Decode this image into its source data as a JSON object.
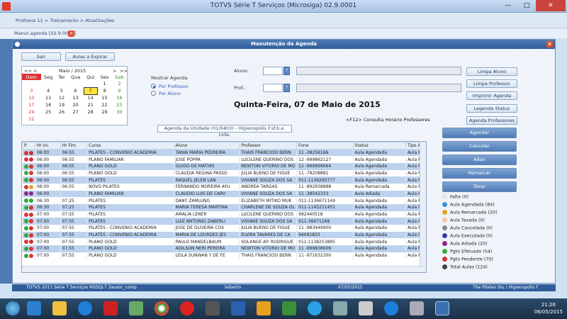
{
  "window": {
    "title": "TOTVS Série T Serviços (Microsiga) 02.9.0001"
  },
  "breadcrumb": "Protheus 11 > Treinamento > Atualizações",
  "tab": {
    "label": "Manut.agenda [02.9.0026]"
  },
  "dialog": {
    "title": "Manutenção da Agenda"
  },
  "toolbar": {
    "sair": "Sair",
    "aulas_expirar": "Aulas a Expirar"
  },
  "calendar": {
    "nav_prev_year": "<<",
    "nav_prev": "<",
    "month": "Maio / 2015",
    "nav_next": ">",
    "nav_next_year": ">>",
    "weekdays": [
      "Dom",
      "Seg",
      "Ter",
      "Qua",
      "Qui",
      "Sex",
      "Sab"
    ],
    "weeks": [
      [
        "",
        "",
        "",
        "",
        "",
        "1",
        "2"
      ],
      [
        "3",
        "4",
        "5",
        "6",
        "7",
        "8",
        "9"
      ],
      [
        "10",
        "11",
        "12",
        "13",
        "14",
        "15",
        "16"
      ],
      [
        "17",
        "18",
        "19",
        "20",
        "21",
        "22",
        "23"
      ],
      [
        "24",
        "25",
        "26",
        "27",
        "28",
        "29",
        "30"
      ],
      [
        "31",
        "",
        "",
        "",
        "",
        "",
        ""
      ]
    ],
    "selected": "7"
  },
  "mostrar": {
    "label": "Mostrar Agenda",
    "opt1": "Por Professor",
    "opt2": "Por Aluno"
  },
  "aluno_label": "Aluno:",
  "prof_label": "Prof.:",
  "date_heading": "Quinta-Feira, 07 de Maio de 2015",
  "f12_hint": "<F12> Consulta Horário Professores",
  "right_buttons": [
    "Limpa Aluno",
    "Limpa Professor",
    "Imprimir Agenda",
    "Legenda Status",
    "Agenda Professores"
  ],
  "agenda_tab": "Agenda da Unidade (01/0403) - Higienopolis F.sf.b.e. Ltda.",
  "grid": {
    "columns": [
      "P.",
      "Hr Ini",
      "Hr Fim",
      "Curso",
      "Aluno",
      "Professor",
      "Fone",
      "Status",
      "Tipo Aul"
    ],
    "rows": [
      {
        "c": [
          "#d33",
          "#c33"
        ],
        "v": [
          "06:00",
          "06:55",
          "PILATES - CONVENIO ACADEMIA",
          "TANIA MARIA PEDREIRA",
          "THAIS FRANCIOSI BERN",
          "11 -38256186",
          "Aula Agendada",
          "Aula Fix"
        ]
      },
      {
        "c": [
          "#d33",
          "#c33"
        ],
        "v": [
          "06:00",
          "06:55",
          "PLANO FAMILIAR",
          "JOSE POPPA",
          "LUCILENE QUERINO DOS",
          "12 -999862127",
          "Aula Agendada",
          "Aula Fix"
        ]
      },
      {
        "c": [
          "#3a3",
          "#d33"
        ],
        "v": [
          "06:00",
          "06:55",
          "PLANO GOLD",
          "GUIDO DE MATHIS",
          "NEWTON VITORIO DE MO",
          "11 -999999664",
          "Aula Agendada",
          "Aula Fix"
        ]
      },
      {
        "c": [
          "#3a3",
          "#d33"
        ],
        "v": [
          "06:00",
          "06:55",
          "PLANO GOLD",
          "CLAUDIA REGINA PASSO",
          "JULIA BUENO DE FIGUE",
          "11 -78208881",
          "Aula Agendada",
          "Aula Fix"
        ]
      },
      {
        "c": [
          "#3a3",
          "#d33"
        ],
        "v": [
          "06:00",
          "06:55",
          "PILATES",
          "RAQUEL JELEN LAN",
          "VIVIANE SOUZA DOS SA",
          "011-1136260777",
          "Aula Agendada",
          "Aula Fix"
        ]
      },
      {
        "c": [
          "#d33",
          "#e9a020"
        ],
        "v": [
          "06:00",
          "06:55",
          "NOVO PILATES",
          "FERNANDO MOREIRA AYU",
          "ANDREA TARGAS",
          "11 -892938888",
          "Aula Remarcada",
          "Aula Fix"
        ]
      },
      {
        "c": [
          "#8a2a8a",
          "#8a2a8a"
        ],
        "v": [
          "06:00",
          "",
          "PLANO FAMILIAR",
          "CLAUDIO LUIS DE CARV",
          "VIVIANE SOUZA DOS SA",
          "11 -38542333",
          "Aula Adiada",
          "Aula Fix"
        ]
      },
      {
        "c": [
          "#3a3",
          "#3a3"
        ],
        "v": [
          "06:30",
          "07:25",
          "PILATES",
          "DANY ZAMLUNG",
          "ELIZABETH MITIKO MUK",
          "011-1136671149",
          "Aula Agendada",
          "Aula Fix"
        ]
      },
      {
        "c": [
          "#3a3",
          "#d33"
        ],
        "v": [
          "06:30",
          "07:25",
          "PILATES",
          "MARIA TERESA MARTINA",
          "CHARLENE DE SOUZA OL",
          "011-1145251451",
          "Aula Agendada",
          "Aula Fix"
        ]
      },
      {
        "c": [
          "#d33",
          "#c33"
        ],
        "v": [
          "07:00",
          "07:55",
          "PILATES",
          "AMALIA LENER",
          "LUCILENE QUERINO DOS",
          "982440518",
          "Aula Agendada",
          "Aula Fix"
        ]
      },
      {
        "c": [
          "#3a3",
          "#d33"
        ],
        "v": [
          "07:00",
          "07:55",
          "PILATES",
          "LUIZ ANTONIO ZABERLI",
          "VIVIANE SOUZA DOS SA",
          "011-36671168",
          "Aula Agendada",
          "Aula Fix"
        ]
      },
      {
        "c": [
          "#3a3",
          "#d33"
        ],
        "v": [
          "07:00",
          "07:55",
          "PILATES - CONVENIO ACADEMIA",
          "JOSE DE OLIVEIRA COS",
          "JULIA BUENO DE FIGUE",
          "11 -983449900",
          "Aula Agendada",
          "Aula Fix"
        ]
      },
      {
        "c": [
          "#3a3",
          "#d33"
        ],
        "v": [
          "07:00",
          "07:55",
          "PILATES - CONVENIO ACADEMIA",
          "MARIA DE LOURDES JES",
          "ELVIRA TAVARES DE CA",
          "96081833",
          "Aula Agendada",
          "Aula Fix"
        ]
      },
      {
        "c": [
          "#d33",
          "#c33"
        ],
        "v": [
          "07:00",
          "07:55",
          "PLANO GOLD",
          "PAULO MANDELBAUM",
          "SOLANGE AP. RODRIGUE",
          "011-1138253895",
          "Aula Agendada",
          "Aula Fix"
        ]
      },
      {
        "c": [
          "#3a3",
          "#d33"
        ],
        "v": [
          "07:00",
          "07:55",
          "PLANO GOLD",
          "ADILSON NERI PEREIRA",
          "NEWTON VITORIO DE MO",
          "11 -999838606",
          "Aula Agendada",
          "Aula Fix"
        ]
      },
      {
        "c": [
          "#3a3",
          "#d33"
        ],
        "v": [
          "07:00",
          "07:55",
          "PLANO GOLD",
          "LEILA SUNWAN Y DE FE",
          "THAIS FRANCIOSI BERN",
          "11 -971632300",
          "Aula Agendada",
          "Aula Fix"
        ]
      }
    ]
  },
  "actions": [
    "Agendar",
    "Cancelar",
    "Adiar",
    "Remarcar",
    "Taxar"
  ],
  "legend": [
    {
      "color": "#e5e5e5",
      "label": "Falta (0)"
    },
    {
      "color": "#3a8fd8",
      "label": "Aula Agendada (84)"
    },
    {
      "color": "#e9a020",
      "label": "Aula Remarcada (20)"
    },
    {
      "color": "#f0c8a0",
      "label": "Aula Taxada (0)"
    },
    {
      "color": "#888888",
      "label": "Aula Cancelada (0)"
    },
    {
      "color": "#3a3aa8",
      "label": "Aula Executada (0)"
    },
    {
      "color": "#8a2a8a",
      "label": "Aula Adiada (20)"
    },
    {
      "color": "#3aa83a",
      "label": "Pgto Efetuado (54)"
    },
    {
      "color": "#d33333",
      "label": "Pgto Pendente (70)"
    },
    {
      "color": "#444444",
      "label": "Total Aulas (124)"
    }
  ],
  "status": {
    "left": "TOTVS 2011 Série T Serviços MSSQL7 3ausor_comp",
    "user": "laiberto",
    "date": "07/05/2015",
    "company": "The Pilates Stu / Higienopolis F"
  },
  "clock": {
    "time": "21:26",
    "date": "06/05/2015"
  }
}
